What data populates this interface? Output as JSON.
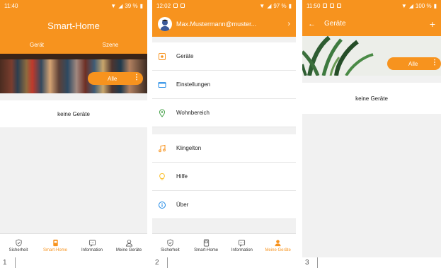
{
  "colors": {
    "accent": "#f7931e",
    "background": "#f1f1f1"
  },
  "screen1": {
    "status_time": "11:40",
    "status_battery": "39 %",
    "title": "Smart-Home",
    "tabs": [
      "Gerät",
      "Szene"
    ],
    "filter_label": "Alle",
    "empty_text": "keine Geräte",
    "tabbar": [
      "Sicherheit",
      "Smart-Home",
      "Information",
      "Meine Geräte"
    ],
    "active_tab": "Smart-Home",
    "frame_number": "1"
  },
  "screen2": {
    "status_time": "12:02",
    "status_battery": "97 %",
    "account_email": "Max.Mustermann@muster...",
    "menu_group_1": [
      {
        "label": "Geräte",
        "icon": "device-icon"
      },
      {
        "label": "Einstellungen",
        "icon": "settings-card-icon"
      },
      {
        "label": "Wohnbereich",
        "icon": "location-pin-icon"
      }
    ],
    "menu_group_2": [
      {
        "label": "Klingelton",
        "icon": "music-note-icon"
      },
      {
        "label": "Hilfe",
        "icon": "lightbulb-icon"
      },
      {
        "label": "Über",
        "icon": "info-icon"
      }
    ],
    "tabbar": [
      "Sicherheit",
      "Smart-Home",
      "Information",
      "Meine Geräte"
    ],
    "active_tab": "Meine Geräte",
    "frame_number": "2"
  },
  "screen3": {
    "status_time": "11:50",
    "status_battery": "100 %",
    "title": "Geräte",
    "filter_label": "Alle",
    "empty_text": "keine Geräte",
    "frame_number": "3"
  }
}
